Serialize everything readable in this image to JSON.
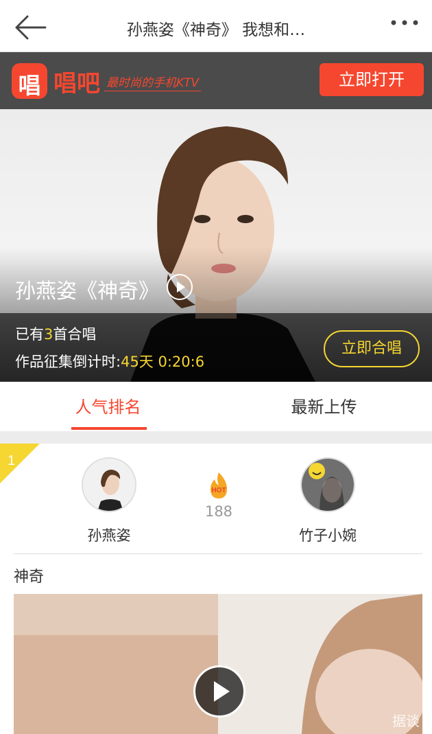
{
  "nav": {
    "title": "孙燕姿《神奇》 我想和…",
    "back_icon": "arrow-left-icon",
    "more_icon": "more-dots-icon"
  },
  "banner": {
    "logo_char": "唱",
    "app_name": "唱吧",
    "slogan": "最时尚的手机KTV",
    "open_label": "立即打开",
    "accent": "#f5472f"
  },
  "hero": {
    "song_title": "孙燕姿《神奇》",
    "count_prefix": "已有",
    "count_value": "3",
    "count_suffix": "首合唱",
    "countdown_label": "作品征集倒计时:",
    "countdown_value": "45天 0:20:6",
    "duet_label": "立即合唱",
    "highlight": "#f6d630"
  },
  "tabs": {
    "active": "人气排名",
    "inactive": "最新上传"
  },
  "ranking": {
    "rank": "1",
    "left_singer": "孙燕姿",
    "right_singer": "竹子小婉",
    "hot_badge": "HOT",
    "hot_count": "188"
  },
  "video": {
    "title": "神奇",
    "play_icon": "play-icon",
    "watermark": "据谈"
  }
}
